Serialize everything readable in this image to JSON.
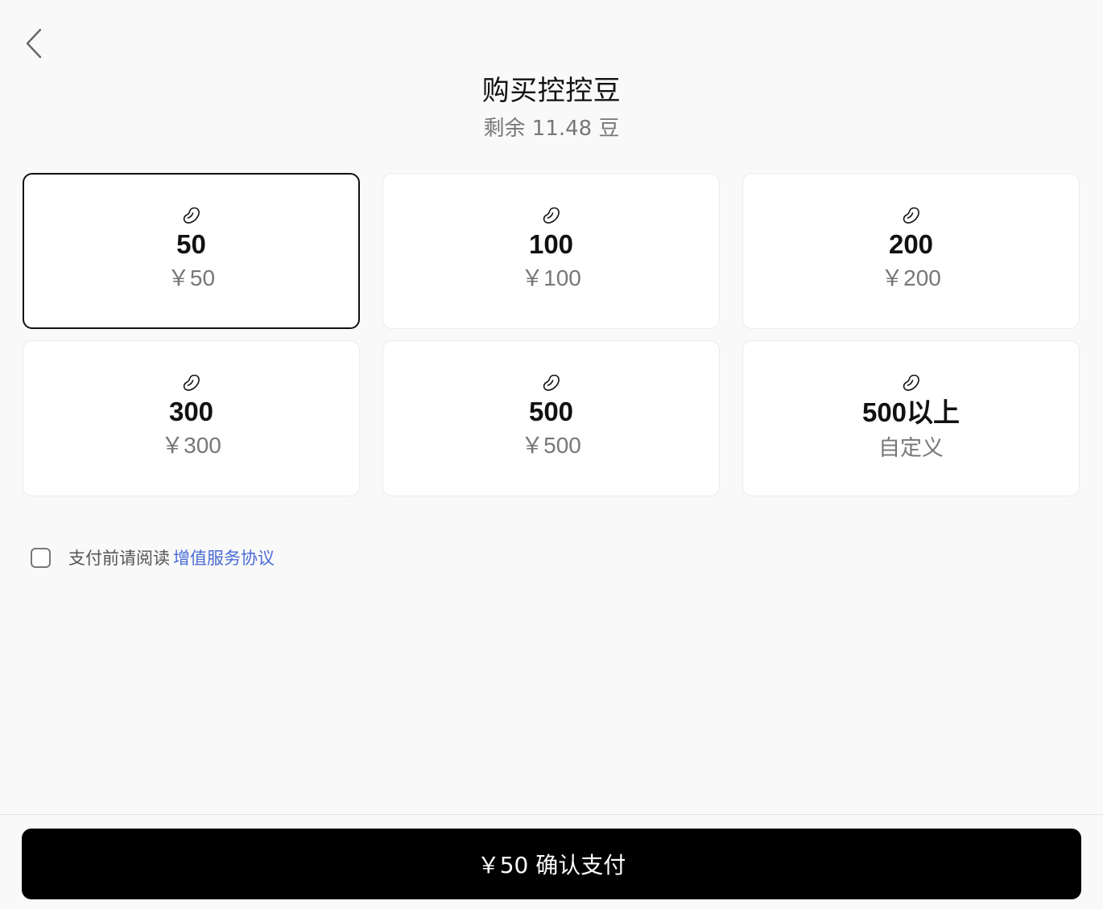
{
  "nav": {
    "back_icon": "chevron-left-icon"
  },
  "header": {
    "title": "购买控控豆",
    "balance": "剩余 11.48 豆"
  },
  "packages": [
    {
      "amount": "50",
      "price": "￥50",
      "selected": true
    },
    {
      "amount": "100",
      "price": "￥100",
      "selected": false
    },
    {
      "amount": "200",
      "price": "￥200",
      "selected": false
    },
    {
      "amount": "300",
      "price": "￥300",
      "selected": false
    },
    {
      "amount": "500",
      "price": "￥500",
      "selected": false
    },
    {
      "amount": "500以上",
      "price": "自定义",
      "selected": false
    }
  ],
  "package_icon": "bean-icon",
  "agreement": {
    "checked": false,
    "text": "支付前请阅读",
    "link_text": "增值服务协议"
  },
  "footer": {
    "pay_label": "￥50 确认支付"
  },
  "colors": {
    "background": "#f9f9f9",
    "card": "#ffffff",
    "selected_border": "#111111",
    "link": "#4a6bd6",
    "pay_button": "#000000"
  }
}
